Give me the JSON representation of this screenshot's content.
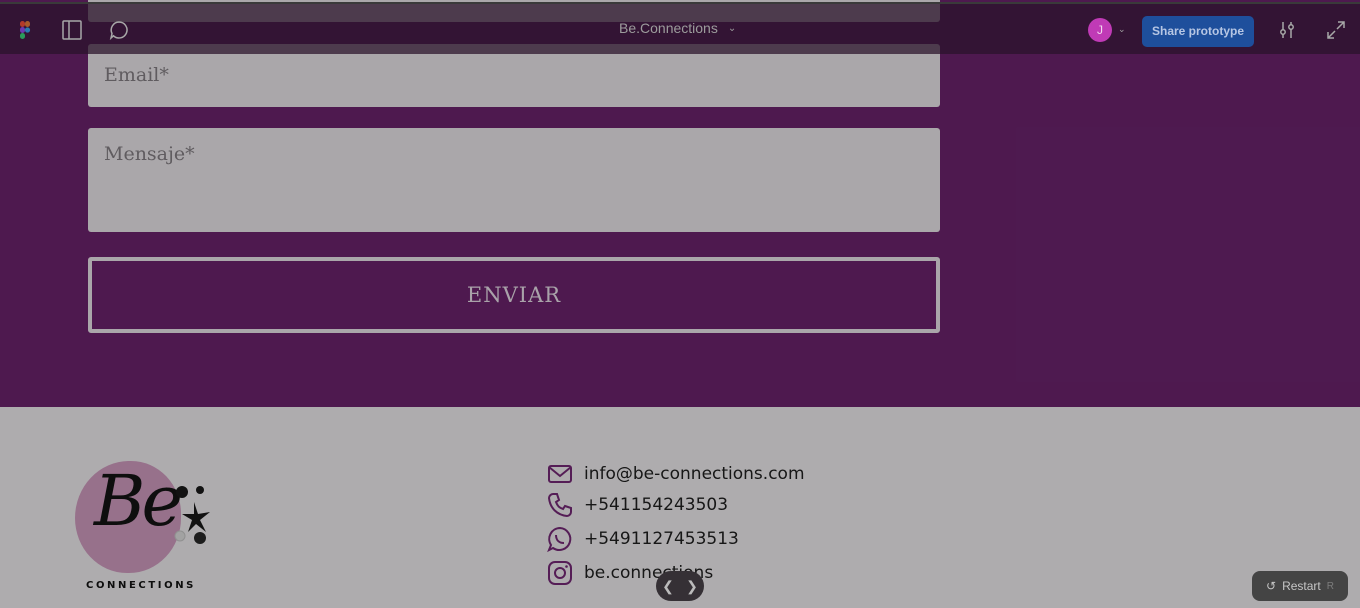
{
  "app": {
    "title": "Be.Connections",
    "share_label": "Share prototype",
    "avatar_initial": "J",
    "restart_label": "Restart",
    "restart_shortcut": "R"
  },
  "form": {
    "email_placeholder": "Email*",
    "message_placeholder": "Mensaje*",
    "submit_label": "ENVIAR"
  },
  "footer": {
    "logo_script": "Be",
    "logo_text": "CONNECTIONS",
    "contacts": [
      {
        "icon": "mail-icon",
        "text": "info@be-connections.com"
      },
      {
        "icon": "phone-icon",
        "text": "+541154243503"
      },
      {
        "icon": "whatsapp-icon",
        "text": "+5491127453513"
      },
      {
        "icon": "instagram-icon",
        "text": "be.connections"
      }
    ]
  },
  "colors": {
    "brand_purple": "#702572",
    "accent": "#1e4f9c"
  }
}
